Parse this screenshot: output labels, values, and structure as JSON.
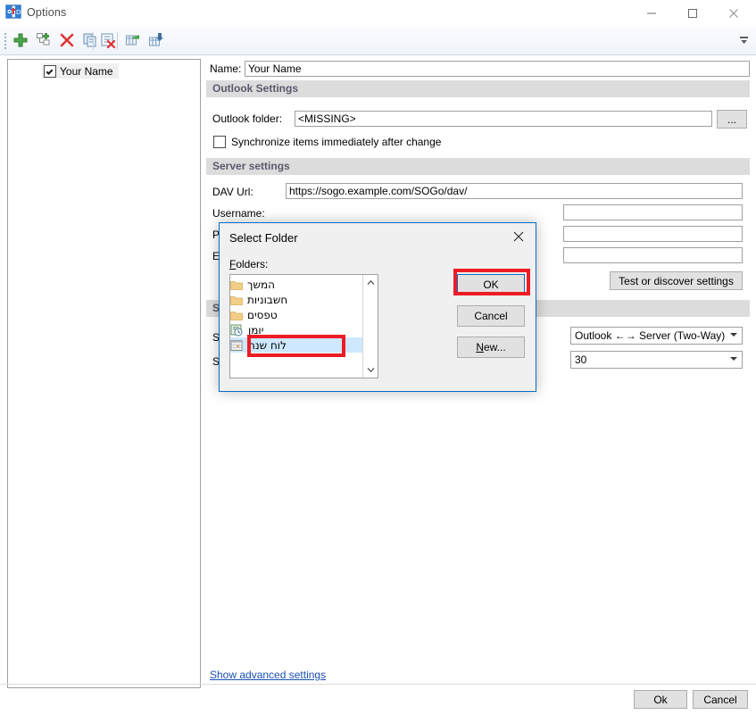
{
  "window": {
    "title": "Options",
    "icon": "outlook-sync-app-icon",
    "controls": {
      "minimize": "minimize-icon",
      "maximize": "maximize-icon",
      "close": "close-icon"
    }
  },
  "toolbar": {
    "buttons": [
      {
        "name": "add-account-button",
        "icon": "green-plus-icon"
      },
      {
        "name": "add-profile-button",
        "icon": "add-node-icon"
      },
      {
        "name": "delete-button",
        "icon": "red-x-icon"
      },
      {
        "name": "copy-button",
        "icon": "copy-icon"
      },
      {
        "name": "clear-button",
        "icon": "clear-list-icon"
      },
      {
        "name": "export-settings-button",
        "icon": "export-icon"
      },
      {
        "name": "import-settings-button",
        "icon": "import-icon"
      }
    ],
    "overflow": "toolbar-overflow-chevron"
  },
  "sidebar": {
    "items": [
      {
        "label": "Your Name",
        "checked": true,
        "selected": true
      }
    ]
  },
  "main": {
    "name_field": {
      "label": "Name:",
      "value": "Your Name"
    },
    "outlook_settings": {
      "header": "Outlook Settings",
      "folder_label": "Outlook folder:",
      "folder_value": "<MISSING>",
      "browse_button": "...",
      "sync_immediately": {
        "label": "Synchronize items immediately after change",
        "checked": false
      }
    },
    "server_settings": {
      "header": "Server settings",
      "dav_url_label": "DAV Url:",
      "dav_url_value": "https://sogo.example.com/SOGo/dav/",
      "username_label": "Username:",
      "username_value": "",
      "password_label": "Pa",
      "password_value": "",
      "encryption_label": "En",
      "encryption_value": "",
      "test_button": "Test or discover settings"
    },
    "sync_settings": {
      "header": "Sy",
      "row1_label": "Sy",
      "row1_value": "Outlook ←→ Server (Two-Way)",
      "row2_label": "Sv",
      "row2_value": "30"
    },
    "advanced_link": "Show advanced settings",
    "ok_button": "Ok",
    "cancel_button": "Cancel"
  },
  "modal": {
    "title": "Select Folder",
    "close_icon": "close-icon",
    "folders_label": "Folders:",
    "folders_label_accel": "F",
    "folders": [
      {
        "label": "המשך",
        "icon": "folder-icon",
        "selected": false
      },
      {
        "label": "חשבוניות",
        "icon": "folder-icon",
        "selected": false
      },
      {
        "label": "טפסים",
        "icon": "folder-icon",
        "selected": false
      },
      {
        "label": "יומן",
        "icon": "journal-icon",
        "selected": false
      },
      {
        "label": "לוח שנה",
        "icon": "calendar-icon",
        "selected": true
      }
    ],
    "scrollbar": {
      "up": "chevron-up-icon",
      "down": "chevron-down-icon"
    },
    "buttons": {
      "ok": "OK",
      "cancel": "Cancel",
      "new": "New...",
      "new_accel": "N"
    }
  },
  "annotations": {
    "highlight_color": "#ee1c25",
    "targets": [
      "ok-button",
      "selected-folder-row"
    ]
  }
}
